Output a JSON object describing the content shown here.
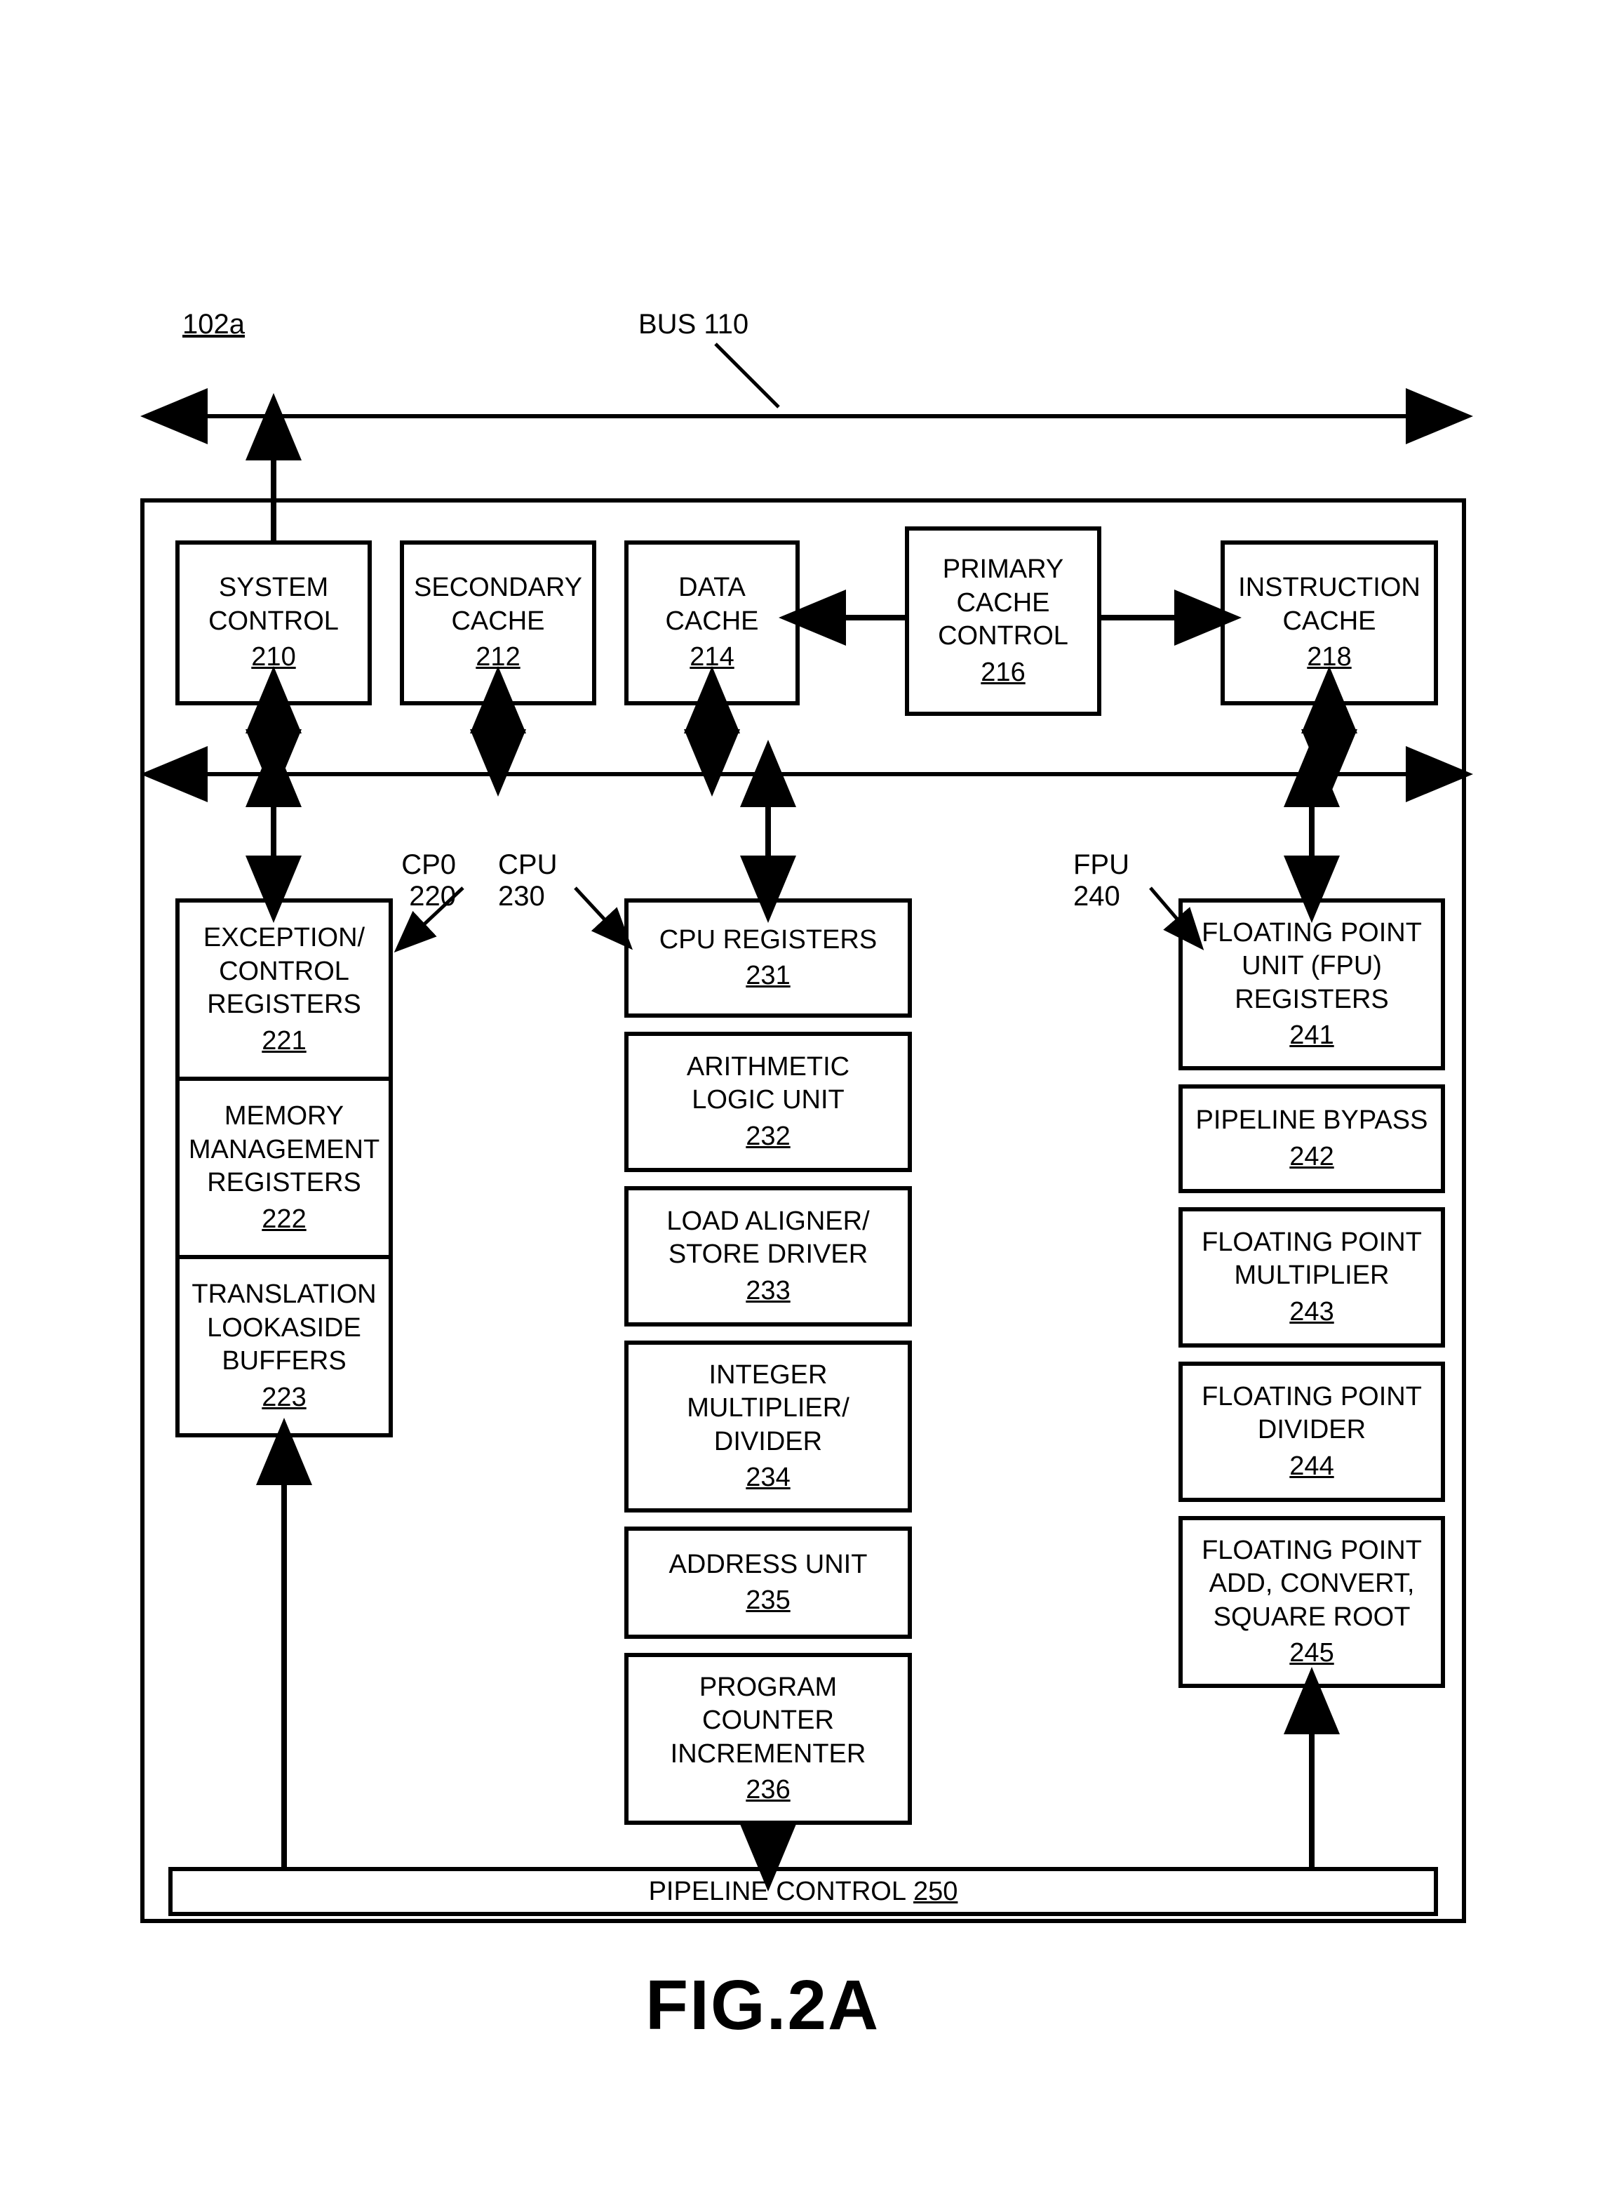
{
  "figure_ref": "102a",
  "bus_label": "BUS 110",
  "figure_caption": "FIG.2A",
  "top_row": {
    "system_control": {
      "title": "SYSTEM CONTROL",
      "ref": "210"
    },
    "secondary_cache": {
      "title": "SECONDARY CACHE",
      "ref": "212"
    },
    "data_cache": {
      "title": "DATA CACHE",
      "ref": "214"
    },
    "primary_cache_control": {
      "title_l1": "PRIMARY",
      "title_l2": "CACHE",
      "title_l3": "CONTROL",
      "ref": "216"
    },
    "instruction_cache": {
      "title": "INSTRUCTION CACHE",
      "ref": "218"
    }
  },
  "pointers": {
    "cp0": {
      "label": "CP0",
      "ref": "220"
    },
    "cpu": {
      "label": "CPU",
      "ref": "230"
    },
    "fpu": {
      "label": "FPU",
      "ref": "240"
    }
  },
  "cp0_stack": {
    "exception_control_registers": {
      "l1": "EXCEPTION/",
      "l2": "CONTROL",
      "l3": "REGISTERS",
      "ref": "221"
    },
    "memory_management_registers": {
      "l1": "MEMORY",
      "l2": "MANAGEMENT",
      "l3": "REGISTERS",
      "ref": "222"
    },
    "translation_lookaside_buffers": {
      "l1": "TRANSLATION",
      "l2": "LOOKASIDE",
      "l3": "BUFFERS",
      "ref": "223"
    }
  },
  "cpu_stack": {
    "cpu_registers": {
      "title": "CPU REGISTERS",
      "ref": "231"
    },
    "alu": {
      "l1": "ARITHMETIC",
      "l2": "LOGIC UNIT",
      "ref": "232"
    },
    "load_store": {
      "l1": "LOAD ALIGNER/",
      "l2": "STORE DRIVER",
      "ref": "233"
    },
    "int_mul_div": {
      "l1": "INTEGER",
      "l2": "MULTIPLIER/",
      "l3": "DIVIDER",
      "ref": "234"
    },
    "address_unit": {
      "title": "ADDRESS UNIT",
      "ref": "235"
    },
    "pc_inc": {
      "l1": "PROGRAM",
      "l2": "COUNTER",
      "l3": "INCREMENTER",
      "ref": "236"
    }
  },
  "fpu_stack": {
    "fpu_registers": {
      "l1": "FLOATING POINT",
      "l2": "UNIT (FPU)",
      "l3": "REGISTERS",
      "ref": "241"
    },
    "pipeline_bypass": {
      "title": "PIPELINE BYPASS",
      "ref": "242"
    },
    "fp_multiplier": {
      "l1": "FLOATING POINT",
      "l2": "MULTIPLIER",
      "ref": "243"
    },
    "fp_divider": {
      "l1": "FLOATING POINT",
      "l2": "DIVIDER",
      "ref": "244"
    },
    "fp_add_conv_sqrt": {
      "l1": "FLOATING POINT",
      "l2": "ADD, CONVERT,",
      "l3": "SQUARE ROOT",
      "ref": "245"
    }
  },
  "pipeline_control": {
    "title": "PIPELINE CONTROL",
    "ref": "250"
  }
}
